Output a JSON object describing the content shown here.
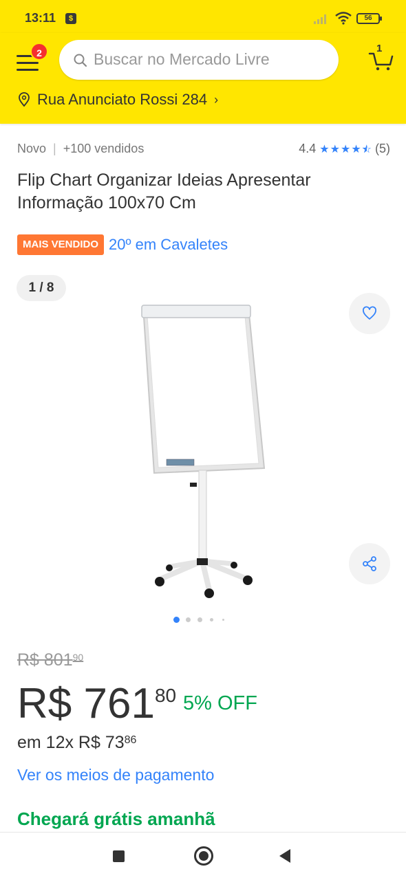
{
  "status_bar": {
    "time": "13:11",
    "battery": "56"
  },
  "header": {
    "menu_badge_count": "2",
    "search_placeholder": "Buscar no Mercado Livre",
    "cart_count": "1",
    "address": "Rua Anunciato Rossi 284",
    "address_chevron": "›",
    "colors": {
      "brand_yellow": "#ffe600",
      "badge_red": "#f52f2f"
    }
  },
  "product": {
    "condition": "Novo",
    "separator": "|",
    "sold": "+100 vendidos",
    "rating_value": "4.4",
    "rating_stars": 4.4,
    "rating_count": "(5)",
    "title": "Flip Chart Organizar Ideias Apresentar Informação 100x70 Cm",
    "best_seller_badge": "MAIS VENDIDO",
    "ranking_link": "20º em Cavaletes"
  },
  "gallery": {
    "counter": "1 / 8",
    "current_image": 1,
    "total_images": 8,
    "icons": [
      "heart-icon",
      "share-icon"
    ]
  },
  "pricing": {
    "old_price_main": "R$ 801",
    "old_price_cents": "90",
    "price_main": "R$ 761",
    "price_cents": "80",
    "discount": "5% OFF",
    "installments_main": "em 12x R$ 73",
    "installments_cents": "86",
    "payment_link": "Ver os meios de pagamento",
    "colors": {
      "discount_green": "#00a650",
      "link_blue": "#3483fa"
    }
  },
  "shipping": {
    "text": "Chegará grátis amanhã"
  },
  "nav_bar": {
    "icons": [
      "recent-apps-icon",
      "home-icon",
      "back-icon"
    ]
  }
}
